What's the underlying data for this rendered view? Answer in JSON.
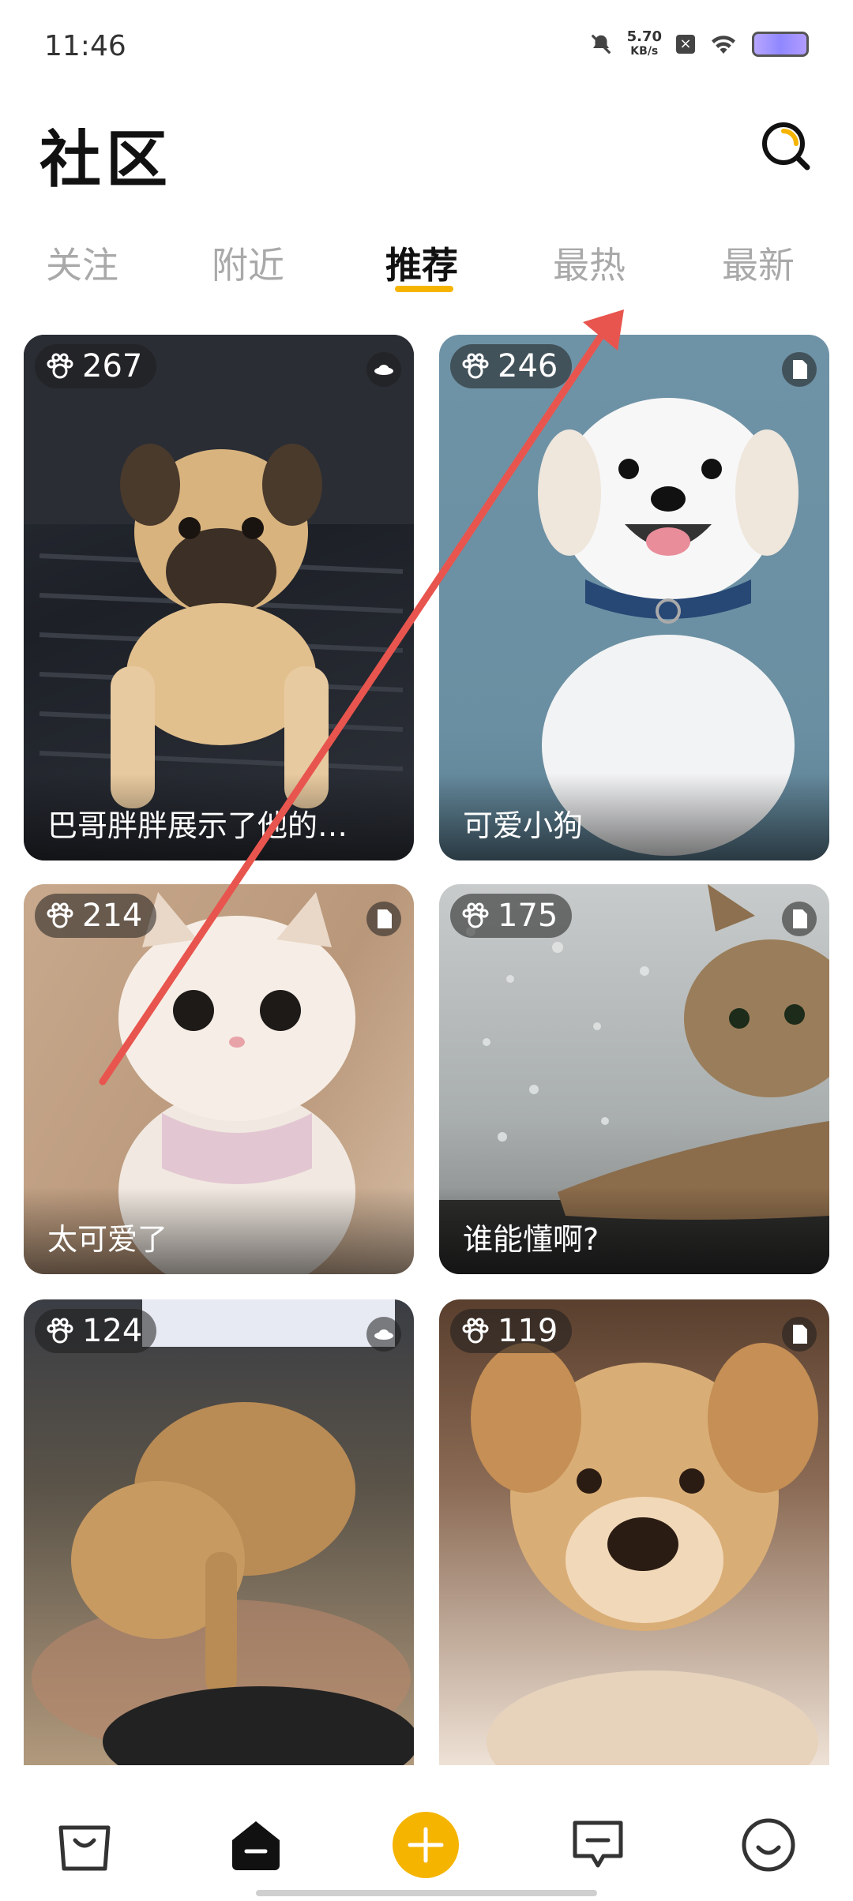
{
  "status_bar": {
    "time": "11:46",
    "speed_value": "5.70",
    "speed_unit": "KB/s"
  },
  "header": {
    "title": "社区"
  },
  "tabs": [
    {
      "label": "关注"
    },
    {
      "label": "附近"
    },
    {
      "label": "推荐"
    },
    {
      "label": "最热"
    },
    {
      "label": "最新"
    }
  ],
  "active_tab": "推荐",
  "posts": [
    {
      "likes": "267",
      "caption": "巴哥胖胖展示了他的…",
      "corner_icon": "ufo-icon"
    },
    {
      "likes": "246",
      "caption": "可爱小狗",
      "corner_icon": "document-icon"
    },
    {
      "likes": "214",
      "caption": "太可爱了",
      "corner_icon": "document-icon"
    },
    {
      "likes": "175",
      "caption": "谁能懂啊?",
      "corner_icon": "document-icon"
    },
    {
      "likes": "124",
      "caption": "",
      "corner_icon": "ufo-icon"
    },
    {
      "likes": "119",
      "caption": "",
      "corner_icon": "document-icon"
    }
  ],
  "bottom_nav": [
    {
      "icon": "shopping-bag-icon"
    },
    {
      "icon": "home-icon"
    },
    {
      "icon": "add-icon"
    },
    {
      "icon": "message-icon"
    },
    {
      "icon": "profile-icon"
    }
  ],
  "colors": {
    "accent": "#f5b400",
    "overlay_arrow": "#e8554e"
  }
}
